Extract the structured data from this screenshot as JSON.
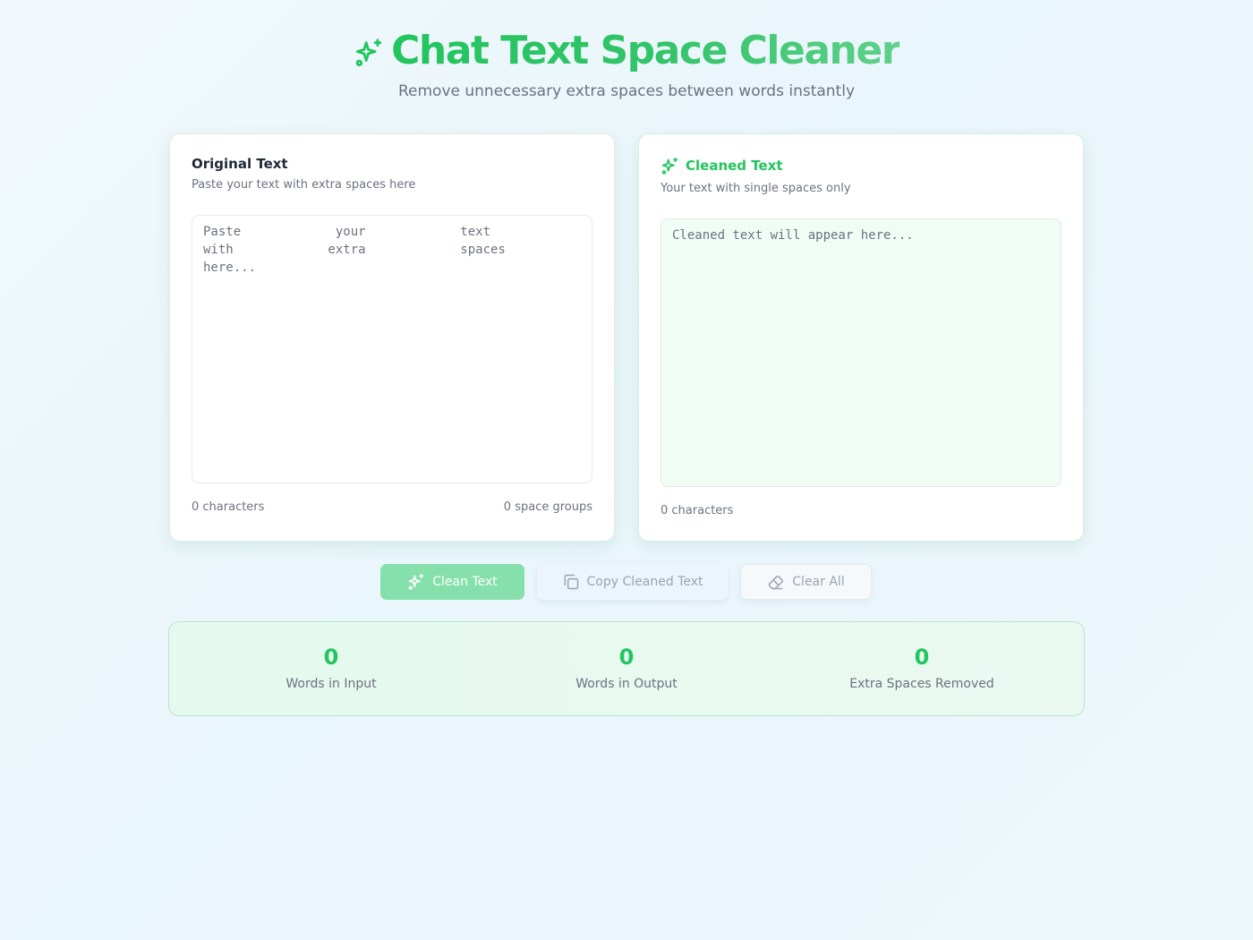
{
  "app": {
    "title": "Chat Text Space Cleaner",
    "subtitle": "Remove unnecessary extra spaces between words instantly",
    "title_icon": "sparkles-icon",
    "accent_color": "#22c55e"
  },
  "input_panel": {
    "title": "Original Text",
    "description": "Paste your text with extra spaces here",
    "placeholder": "Paste    your    text    with    extra    spaces    here...",
    "value": "",
    "char_count": "0 characters",
    "space_groups": "0 space groups"
  },
  "output_panel": {
    "icon": "sparkles-icon",
    "title": "Cleaned Text",
    "description": "Your text with single spaces only",
    "placeholder": "Cleaned text will appear here...",
    "value": "",
    "char_count": "0 characters"
  },
  "actions": {
    "clean_label": "Clean Text",
    "clean_icon": "sparkles-icon",
    "copy_label": "Copy Cleaned Text",
    "copy_icon": "copy-icon",
    "clear_label": "Clear All",
    "clear_icon": "eraser-icon"
  },
  "stats": [
    {
      "value": "0",
      "label": "Words in Input"
    },
    {
      "value": "0",
      "label": "Words in Output"
    },
    {
      "value": "0",
      "label": "Extra Spaces Removed"
    }
  ]
}
